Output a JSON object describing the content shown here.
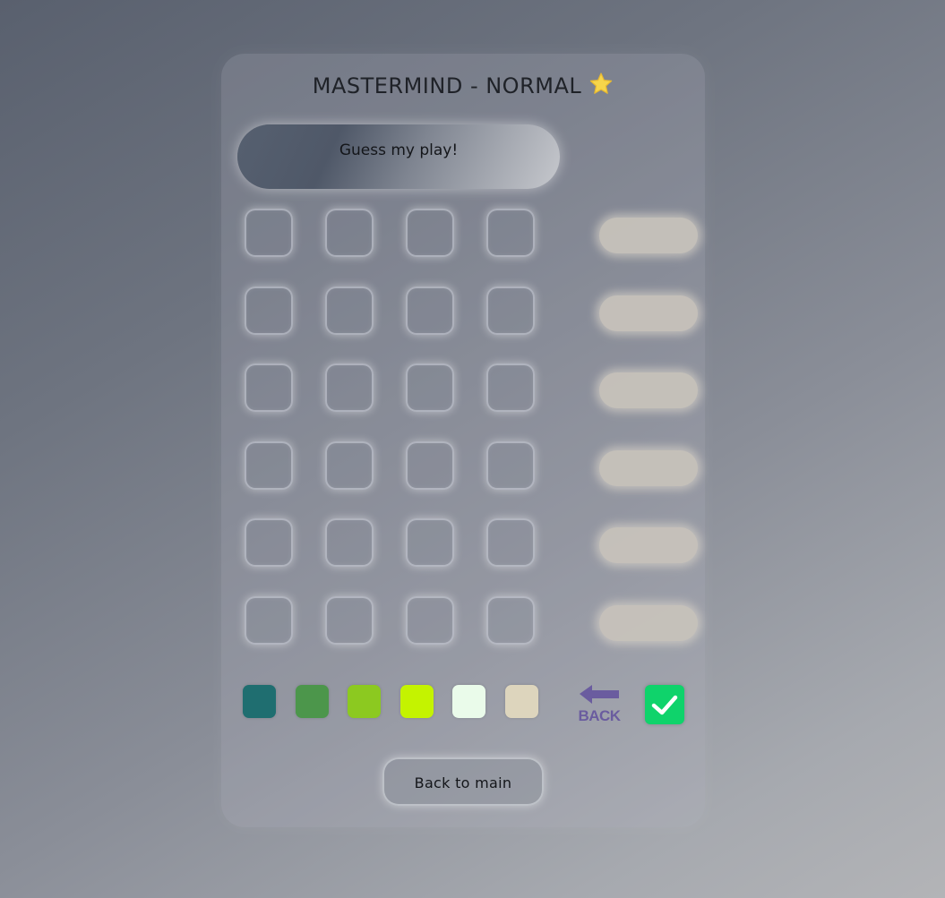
{
  "header": {
    "title": "MASTERMIND - NORMAL",
    "difficulty_icon": "star-icon",
    "star_color": "#f6d54a"
  },
  "message": {
    "text": "Guess my play!"
  },
  "board": {
    "rows": 6,
    "columns": 4,
    "feedback_color": "#c9c4bc"
  },
  "palette": {
    "colors": [
      "#1f6e70",
      "#4c964b",
      "#8cc920",
      "#c4f300",
      "#eafbea",
      "#ddd5bd"
    ]
  },
  "controls": {
    "back_label": "BACK",
    "back_icon": "arrow-left-icon",
    "back_color": "#6a5c9f",
    "confirm_icon": "checkmark-icon",
    "confirm_color": "#0fd36b"
  },
  "footer": {
    "back_to_main_label": "Back to main"
  }
}
